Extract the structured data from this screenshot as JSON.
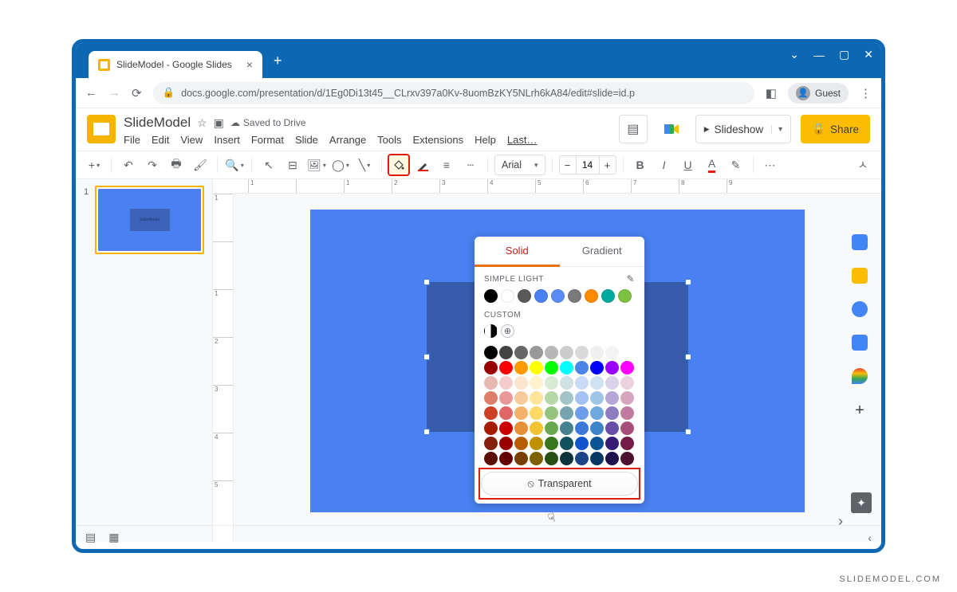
{
  "browser": {
    "tab_title": "SlideModel - Google Slides",
    "url": "docs.google.com/presentation/d/1Eg0Di13t45__CLrxv397a0Kv-8uomBzKY5NLrh6kA84/edit#slide=id.p",
    "guest_label": "Guest"
  },
  "doc": {
    "name": "SlideModel",
    "saved": "Saved to Drive"
  },
  "menu": {
    "file": "File",
    "edit": "Edit",
    "view": "View",
    "insert": "Insert",
    "format": "Format",
    "slide": "Slide",
    "arrange": "Arrange",
    "tools": "Tools",
    "extensions": "Extensions",
    "help": "Help",
    "last": "Last…"
  },
  "header_buttons": {
    "slideshow": "Slideshow",
    "share": "Share"
  },
  "toolbar": {
    "font": "Arial",
    "font_size": "14"
  },
  "slide": {
    "shape_text": "SlideModel",
    "thumb_text": "SlideModel"
  },
  "popup": {
    "tab_solid": "Solid",
    "tab_gradient": "Gradient",
    "theme_label": "SIMPLE LIGHT",
    "custom_label": "CUSTOM",
    "transparent": "Transparent",
    "theme_colors": [
      "#000000",
      "#ffffff",
      "#595959",
      "#4a80f0",
      "#5a8af4",
      "#7a7a7a",
      "#ff8a00",
      "#00a99d",
      "#7cc142"
    ],
    "grid": [
      "#000000",
      "#434343",
      "#666666",
      "#999999",
      "#b7b7b7",
      "#cccccc",
      "#d9d9d9",
      "#efefef",
      "#f3f3f3",
      "#ffffff",
      "#980000",
      "#ff0000",
      "#ff9900",
      "#ffff00",
      "#00ff00",
      "#00ffff",
      "#4a86e8",
      "#0000ff",
      "#9900ff",
      "#ff00ff",
      "#e6b8af",
      "#f4cccc",
      "#fce5cd",
      "#fff2cc",
      "#d9ead3",
      "#d0e0e3",
      "#c9daf8",
      "#cfe2f3",
      "#d9d2e9",
      "#ead1dc",
      "#dd7e6b",
      "#ea9999",
      "#f9cb9c",
      "#ffe599",
      "#b6d7a8",
      "#a2c4c9",
      "#a4c2f4",
      "#9fc5e8",
      "#b4a7d6",
      "#d5a6bd",
      "#cc4125",
      "#e06666",
      "#f6b26b",
      "#ffd966",
      "#93c47d",
      "#76a5af",
      "#6d9eeb",
      "#6fa8dc",
      "#8e7cc3",
      "#c27ba0",
      "#a61c00",
      "#cc0000",
      "#e69138",
      "#f1c232",
      "#6aa84f",
      "#45818e",
      "#3c78d8",
      "#3d85c6",
      "#674ea7",
      "#a64d79",
      "#85200c",
      "#990000",
      "#b45f06",
      "#bf9000",
      "#38761d",
      "#134f5c",
      "#1155cc",
      "#0b5394",
      "#351c75",
      "#741b47",
      "#5b0f00",
      "#660000",
      "#783f04",
      "#7f6000",
      "#274e13",
      "#0c343d",
      "#1c4587",
      "#073763",
      "#20124d",
      "#4c1130"
    ]
  },
  "ruler_h": [
    "1",
    "",
    "1",
    "2",
    "3",
    "4",
    "5",
    "6",
    "7",
    "8",
    "9"
  ],
  "ruler_v": [
    "1",
    "",
    "1",
    "2",
    "3",
    "4",
    "5"
  ],
  "watermark": "SLIDEMODEL.COM"
}
